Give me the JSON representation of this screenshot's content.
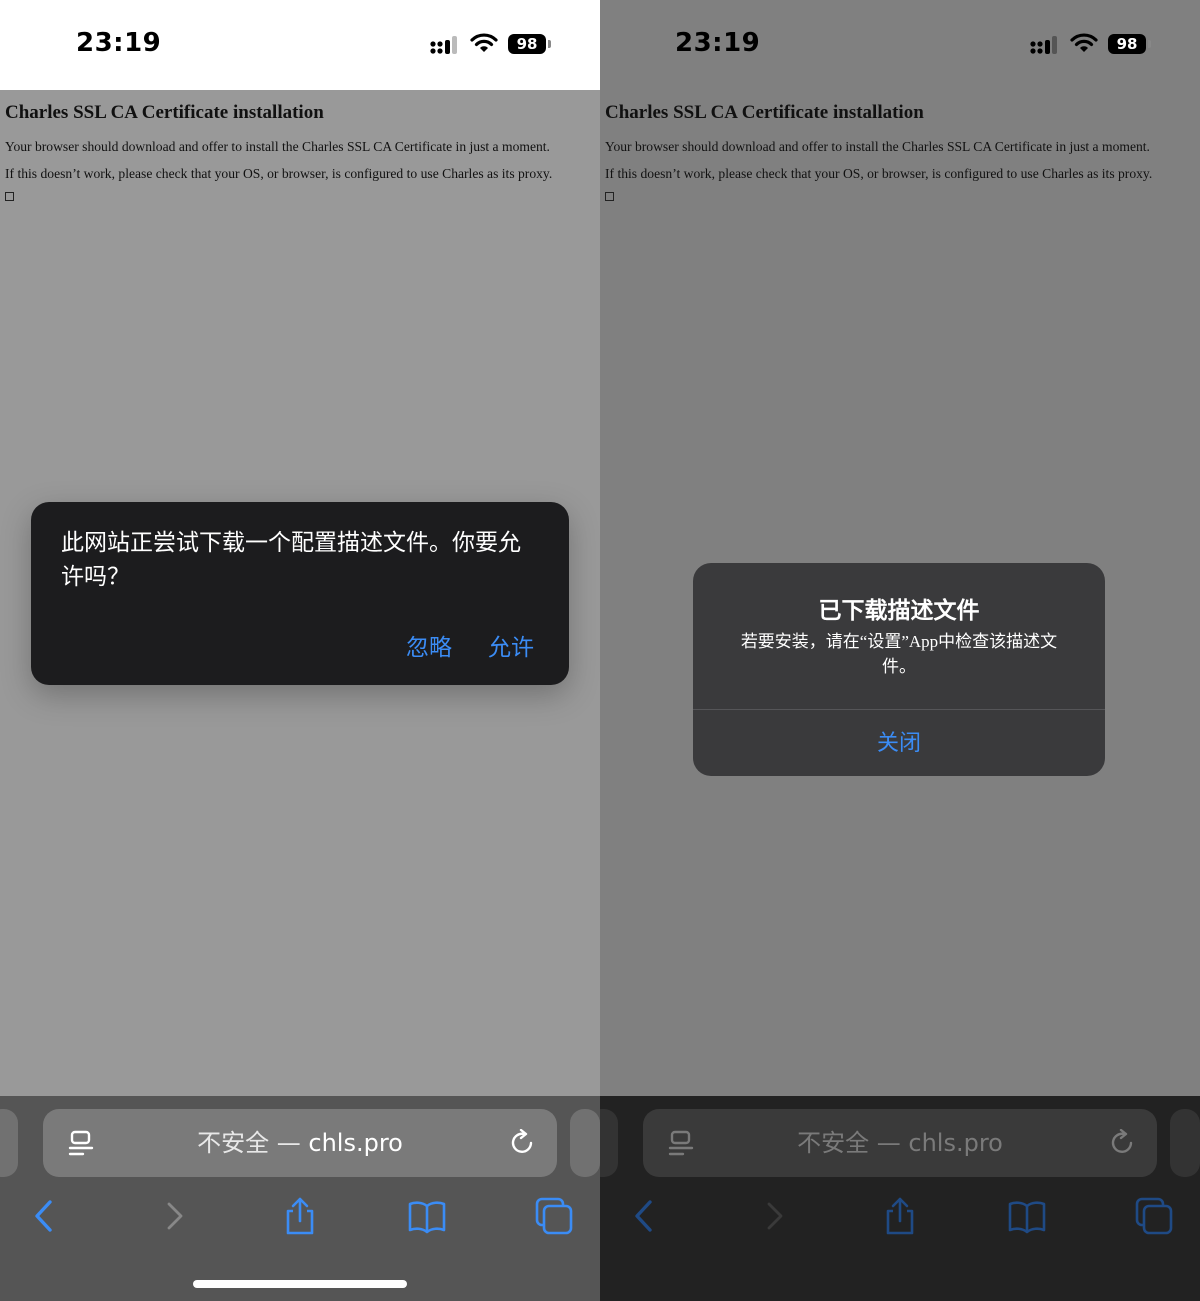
{
  "status_bar": {
    "time": "23:19",
    "battery": "98"
  },
  "page": {
    "title": "Charles SSL CA Certificate installation",
    "paragraph1": "Your browser should download and offer to install the Charles SSL CA Certificate in just a moment.",
    "paragraph2": "If this doesn’t work, please check that your OS, or browser, is configured to use Charles as its proxy."
  },
  "download_prompt": {
    "message": "此网站正尝试下载一个配置描述文件。你要允许吗？",
    "ignore_label": "忽略",
    "allow_label": "允许"
  },
  "downloaded_alert": {
    "title": "已下载描述文件",
    "body": "若要安装，请在“设置”App中检查该描述文件。",
    "close_label": "关闭"
  },
  "address_bar": {
    "security": "不安全 — ",
    "host": "chls.pro"
  },
  "colors": {
    "accent": "#3b8cf5",
    "alert_dark": "#1c1c1e",
    "alert_gray": "#3a3a3c"
  },
  "icons": [
    "reader-icon",
    "reload-icon",
    "back-icon",
    "forward-icon",
    "share-icon",
    "bookmarks-icon",
    "tabs-icon"
  ]
}
